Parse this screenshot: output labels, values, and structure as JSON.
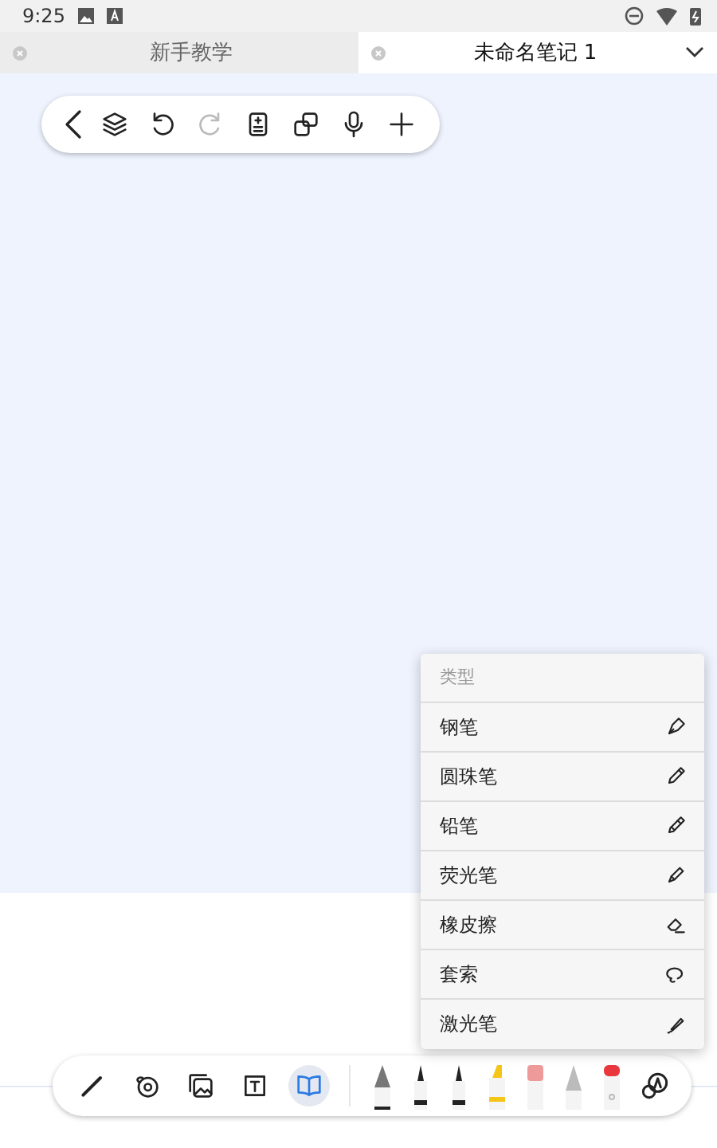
{
  "status_bar": {
    "time": "9:25"
  },
  "tabs": [
    {
      "label": "新手教学",
      "selected": false
    },
    {
      "label": "未命名笔记 1",
      "selected": true
    }
  ],
  "top_toolbar": [
    {
      "kind": "back",
      "disabled": false
    },
    {
      "kind": "layers",
      "disabled": false
    },
    {
      "kind": "undo",
      "disabled": false
    },
    {
      "kind": "redo",
      "disabled": true
    },
    {
      "kind": "page",
      "disabled": false
    },
    {
      "kind": "copy",
      "disabled": false
    },
    {
      "kind": "mic",
      "disabled": false
    },
    {
      "kind": "add",
      "disabled": false
    }
  ],
  "type_menu": {
    "title": "类型",
    "items": [
      {
        "label": "钢笔",
        "kind": "fountain"
      },
      {
        "label": "圆珠笔",
        "kind": "ballpoint"
      },
      {
        "label": "铅笔",
        "kind": "pencil"
      },
      {
        "label": "荧光笔",
        "kind": "highlighter"
      },
      {
        "label": "橡皮擦",
        "kind": "eraser"
      },
      {
        "label": "套索",
        "kind": "lasso"
      },
      {
        "label": "激光笔",
        "kind": "laser"
      }
    ]
  },
  "bottom_tools": [
    {
      "kind": "pen",
      "selected": false
    },
    {
      "kind": "tape",
      "selected": false
    },
    {
      "kind": "image",
      "selected": false
    },
    {
      "kind": "text",
      "selected": false
    },
    {
      "kind": "book",
      "selected": true
    }
  ],
  "pens": [
    {
      "kind": "fountain",
      "color": "#777777"
    },
    {
      "kind": "ballpoint",
      "color": "#222222"
    },
    {
      "kind": "marker",
      "color": "#222222"
    },
    {
      "kind": "highlighter",
      "color": "#f5c518"
    },
    {
      "kind": "eraser",
      "color": "#ee9a9a"
    },
    {
      "kind": "pencil",
      "color": "#bbbbbb"
    },
    {
      "kind": "laser",
      "color": "#e8383d"
    }
  ]
}
